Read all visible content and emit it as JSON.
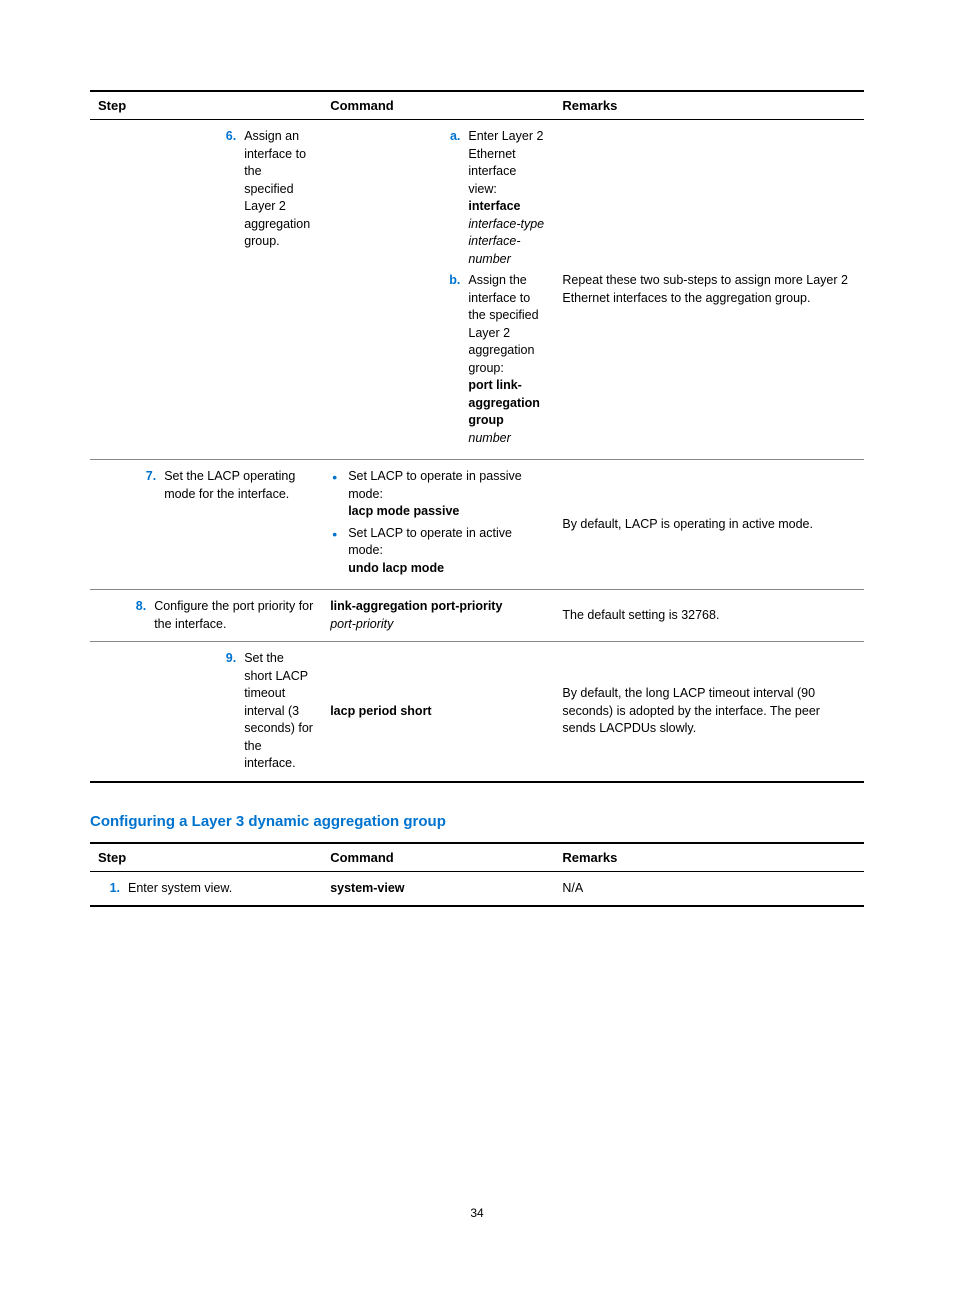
{
  "table1": {
    "head_step": "Step",
    "head_cmd": "Command",
    "head_remark": "Remarks",
    "rows": [
      {
        "step_num": "6.",
        "step_text": "Assign an interface to the specified Layer 2 aggregation group.",
        "cmd_a_num": "a.",
        "cmd_a_pre": "Enter Layer 2 Ethernet interface view:",
        "cmd_a_bold": "interface",
        "cmd_a_ital": "interface-type interface-number",
        "cmd_b_num": "b.",
        "cmd_b_pre": "Assign the interface to the specified Layer 2 aggregation group:",
        "cmd_b_bold": "port link-aggregation group",
        "cmd_b_ital": "number",
        "remark": "Repeat these two sub-steps to assign more Layer 2 Ethernet interfaces to the aggregation group."
      },
      {
        "step_num": "7.",
        "step_text": "Set the LACP operating mode for the interface.",
        "bullet1_pre": "Set LACP to operate in passive mode:",
        "bullet1_bold": "lacp mode passive",
        "bullet2_pre": "Set LACP to operate in active mode:",
        "bullet2_bold": "undo lacp mode",
        "remark": "By default, LACP is operating in active mode."
      },
      {
        "step_num": "8.",
        "step_text": "Configure the port priority for the interface.",
        "cmd_bold": "link-aggregation port-priority",
        "cmd_ital": "port-priority",
        "remark": "The default setting is 32768."
      },
      {
        "step_num": "9.",
        "step_text": "Set the short LACP timeout interval (3 seconds) for the interface.",
        "cmd_bold": "lacp period short",
        "remark": "By default, the long LACP timeout interval (90 seconds) is adopted by the interface. The peer sends LACPDUs slowly."
      }
    ]
  },
  "section_heading": "Configuring a Layer 3 dynamic aggregation group",
  "table2": {
    "head_step": "Step",
    "head_cmd": "Command",
    "head_remark": "Remarks",
    "rows": [
      {
        "step_num": "1.",
        "step_text": "Enter system view.",
        "cmd_bold": "system-view",
        "remark": "N/A"
      }
    ]
  },
  "page_number": "34"
}
